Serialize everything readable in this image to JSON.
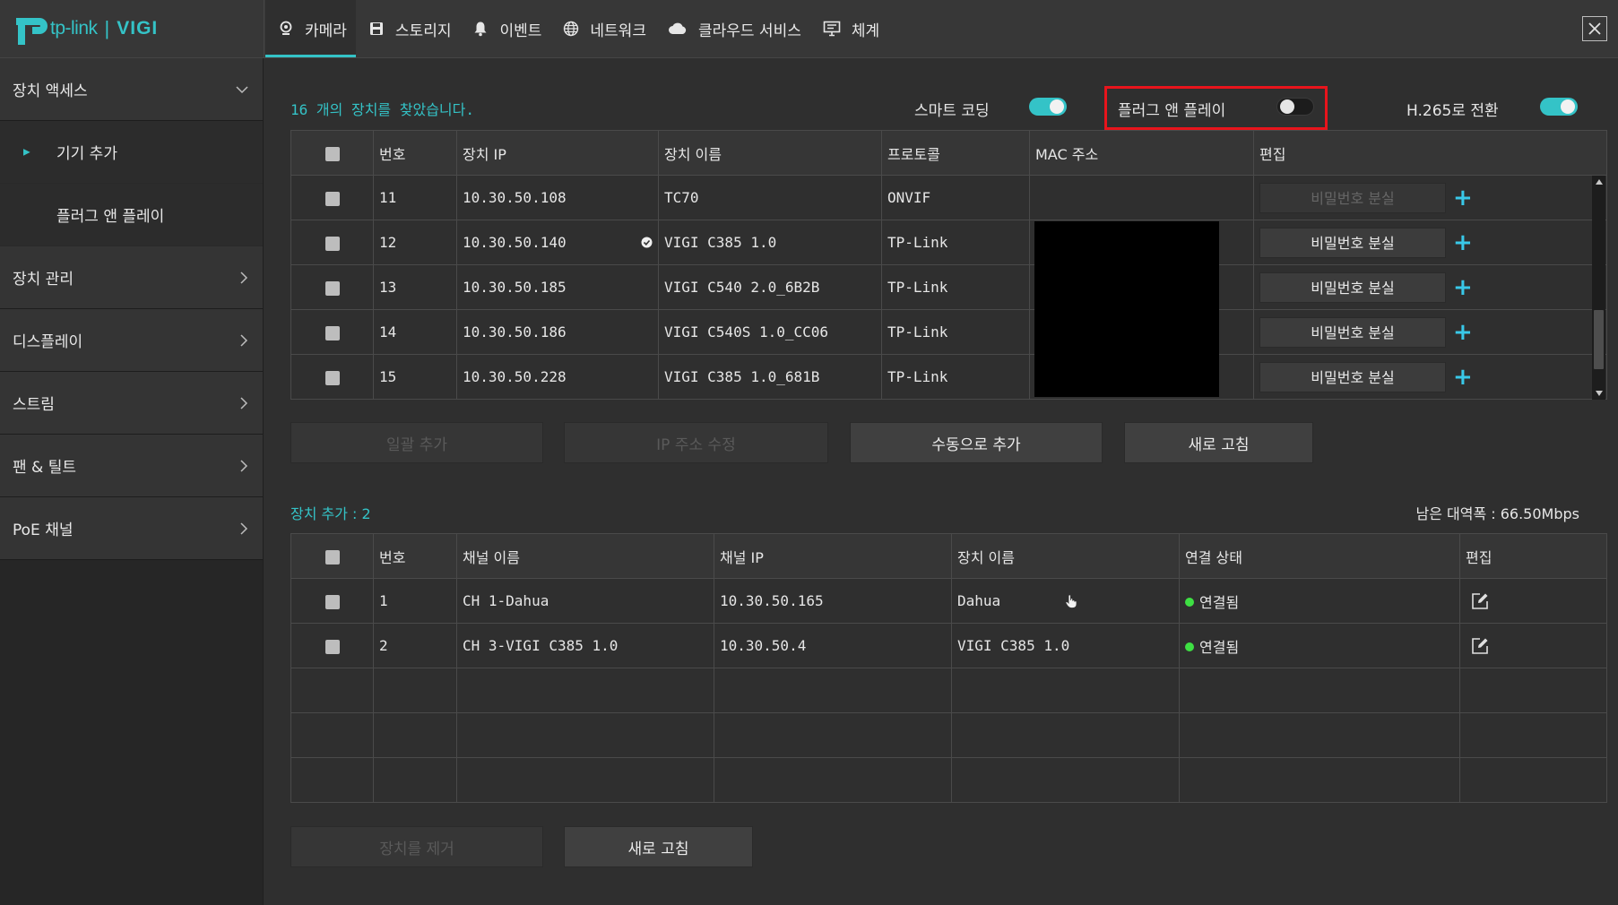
{
  "brand": {
    "name": "tp-link",
    "product": "VIGI",
    "separator": "|"
  },
  "nav": {
    "tabs": [
      {
        "label": "카메라",
        "icon": "camera-icon"
      },
      {
        "label": "스토리지",
        "icon": "storage-icon"
      },
      {
        "label": "이벤트",
        "icon": "bell-icon"
      },
      {
        "label": "네트워크",
        "icon": "globe-icon"
      },
      {
        "label": "클라우드 서비스",
        "icon": "cloud-icon"
      },
      {
        "label": "체계",
        "icon": "system-icon"
      }
    ]
  },
  "sidebar": {
    "items": [
      {
        "label": "장치 액세스"
      },
      {
        "label": "기기 추가"
      },
      {
        "label": "플러그 앤 플레이"
      },
      {
        "label": "장치 관리"
      },
      {
        "label": "디스플레이"
      },
      {
        "label": "스트림"
      },
      {
        "label": "팬 & 틸트"
      },
      {
        "label": "PoE 채널"
      }
    ]
  },
  "discovery": {
    "found_text": "16 개의 장치를 찾았습니다.",
    "smart_coding": {
      "label": "스마트 코딩",
      "state": "on"
    },
    "plug_and_play": {
      "label": "플러그 앤 플레이",
      "state": "off"
    },
    "h265": {
      "label": "H.265로 전환",
      "state": "on"
    },
    "headers": [
      "번호",
      "장치 IP",
      "장치 이름",
      "프로토콜",
      "MAC 주소",
      "편집"
    ],
    "rows": [
      {
        "no": "11",
        "ip": "10.30.50.108",
        "name": "TC70",
        "protocol": "ONVIF",
        "pw": "비밀번호 분실"
      },
      {
        "no": "12",
        "ip": "10.30.50.140",
        "name": "VIGI C385 1.0",
        "protocol": "TP-Link",
        "pw": "비밀번호 분실"
      },
      {
        "no": "13",
        "ip": "10.30.50.185",
        "name": "VIGI C540 2.0_6B2B",
        "protocol": "TP-Link",
        "pw": "비밀번호 분실"
      },
      {
        "no": "14",
        "ip": "10.30.50.186",
        "name": "VIGI C540S 1.0_CC06",
        "protocol": "TP-Link",
        "pw": "비밀번호 분실"
      },
      {
        "no": "15",
        "ip": "10.30.50.228",
        "name": "VIGI C385 1.0_681B",
        "protocol": "TP-Link",
        "pw": "비밀번호 분실"
      }
    ],
    "buttons": {
      "batch_add": "일괄 추가",
      "modify_ip": "IP 주소 수정",
      "manual_add": "수동으로 추가",
      "refresh": "새로 고침"
    }
  },
  "added": {
    "title": "장치 추가 : 2",
    "bandwidth": "남은 대역폭 : 66.50Mbps",
    "headers": [
      "번호",
      "채널 이름",
      "채널 IP",
      "장치 이름",
      "연결 상태",
      "편집"
    ],
    "rows": [
      {
        "no": "1",
        "channel": "CH 1-Dahua",
        "ip": "10.30.50.165",
        "device": "Dahua",
        "status": "연결됨"
      },
      {
        "no": "2",
        "channel": "CH 3-VIGI C385 1.0",
        "ip": "10.30.50.4",
        "device": "VIGI C385 1.0",
        "status": "연결됨"
      }
    ],
    "buttons": {
      "remove": "장치를 제거",
      "refresh": "새로 고침"
    }
  },
  "colors": {
    "accent": "#34c3c7",
    "highlight": "#e8141c",
    "connected": "#3ee043"
  }
}
